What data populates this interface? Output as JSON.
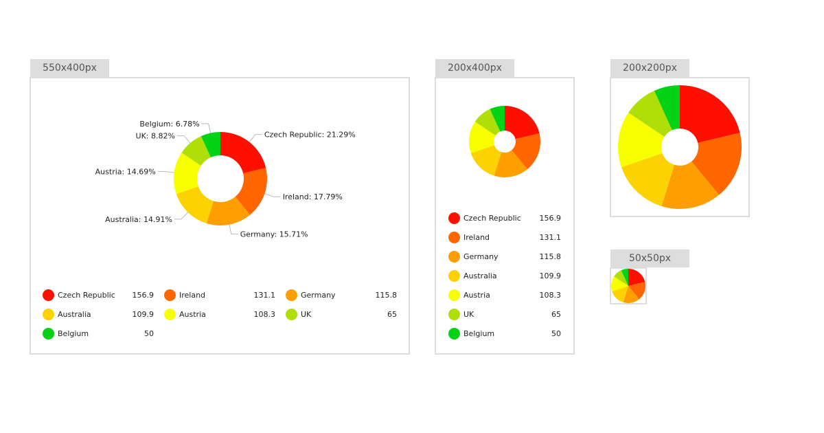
{
  "panels": [
    {
      "id": "large",
      "label": "550x400px",
      "variant": "donut-labels-legend3"
    },
    {
      "id": "narrow",
      "label": "200x400px",
      "variant": "donut-legend1"
    },
    {
      "id": "square",
      "label": "200x200px",
      "variant": "donut-only"
    },
    {
      "id": "tiny",
      "label": "50x50px",
      "variant": "pie-only"
    }
  ],
  "chart_data": {
    "type": "pie",
    "title": "",
    "categories": [
      "Czech Republic",
      "Ireland",
      "Germany",
      "Australia",
      "Austria",
      "UK",
      "Belgium"
    ],
    "values": [
      156.9,
      131.1,
      115.8,
      109.9,
      108.3,
      65,
      50
    ],
    "value_labels": [
      "156.9",
      "131.1",
      "115.8",
      "109.9",
      "108.3",
      "65",
      "50"
    ],
    "percent_labels": [
      "21.29%",
      "17.79%",
      "15.71%",
      "14.91%",
      "14.69%",
      "8.82%",
      "6.78%"
    ],
    "colors": [
      "#ff0f00",
      "#ff6600",
      "#ff9e01",
      "#fcd202",
      "#f8ff01",
      "#b0de09",
      "#04d215"
    ],
    "legend_placement": "bottom",
    "start_angle": "top, clockwise"
  }
}
